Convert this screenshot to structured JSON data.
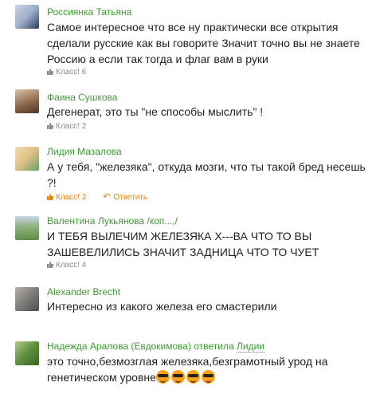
{
  "comments": [
    {
      "author": "Россиянка Татьяна",
      "text": "Самое интересное что все ну практически все открытия сделали русские как вы говорите Значит точно вы не знаете Россию а если так тогда и флаг вам в руки",
      "klass": "Класс! 6",
      "avatar_colors": [
        "#c9d3e4",
        "#2a3a5a"
      ]
    },
    {
      "author": "Фаина Сушкова",
      "text": "Дегенерат, это ты \"не способы мыслить\"  !",
      "klass": "Класс! 2",
      "avatar_colors": [
        "#8f6a4a",
        "#d7c3a8"
      ]
    },
    {
      "author": "Лидия Мазалова",
      "text": "А у тебя, \"железяка\", откуда мозги, что ты такой бред несешь ?!",
      "klass": "Класс! 2",
      "reply_label": "Ответить",
      "avatar_colors": [
        "#e2c287",
        "#6aa06a"
      ]
    },
    {
      "author": "Валентина Лукьянова /коп...,/",
      "text": "И ТЕБЯ ВЫЛЕЧИМ ЖЕЛЕЗЯКА Х---ВА ЧТО ТО ВЫ ЗАШЕВЕЛИЛИСЬ ЗНАЧИТ ЗАДНИЦА  ЧТО ТО ЧУЕТ",
      "klass": "Класс! 4",
      "avatar_colors": [
        "#5f8f4a",
        "#c7d6e8"
      ]
    },
    {
      "author": "Alexander Brecht",
      "text": "Интересно из какого железа его смастерили",
      "avatar_colors": [
        "#7d7d7d",
        "#b8b0a2"
      ]
    },
    {
      "author": "Надежда Аралова (Евдокимова)",
      "reply_prefix": "ответила",
      "reply_to": "Лидии",
      "text": "это точно,безмозглая железяка,безграмотный урод на генетическом уровне",
      "emoji_count": 4,
      "avatar_colors": [
        "#5c8f3c",
        "#b6c98a"
      ]
    }
  ],
  "colors": {
    "author_green": "#3f9933",
    "accent_orange": "#ee8208",
    "meta_gray": "#8a8a8a"
  },
  "icons": {
    "klass": "thumbs-up-icon",
    "reply": "reply-arrow-icon",
    "emoji": "sunglasses-smiley-icon"
  }
}
